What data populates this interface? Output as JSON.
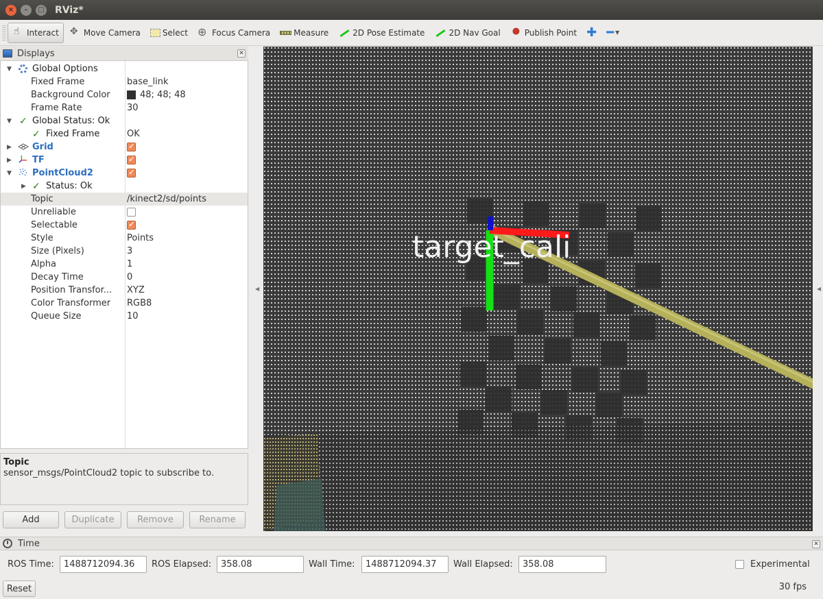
{
  "window": {
    "title": "RViz*"
  },
  "toolbar": {
    "tools": [
      {
        "label": "Interact",
        "icon": "hand-icon",
        "active": true
      },
      {
        "label": "Move Camera",
        "icon": "move-camera-icon"
      },
      {
        "label": "Select",
        "icon": "select-icon"
      },
      {
        "label": "Focus Camera",
        "icon": "focus-camera-icon"
      },
      {
        "label": "Measure",
        "icon": "measure-icon"
      },
      {
        "label": "2D Pose Estimate",
        "icon": "pose-estimate-icon"
      },
      {
        "label": "2D Nav Goal",
        "icon": "nav-goal-icon"
      },
      {
        "label": "Publish Point",
        "icon": "publish-point-icon"
      }
    ],
    "add_tool_icon": "plus-icon",
    "remove_tool_icon": "minus-icon"
  },
  "displays": {
    "title": "Displays",
    "rows": [
      {
        "name": "Global Options",
        "value": ""
      },
      {
        "name": "Fixed Frame",
        "value": "base_link"
      },
      {
        "name": "Background Color",
        "value": "48; 48; 48"
      },
      {
        "name": "Frame Rate",
        "value": "30"
      },
      {
        "name": "Global Status: Ok",
        "value": ""
      },
      {
        "name": "Fixed Frame",
        "value": "OK"
      },
      {
        "name": "Grid",
        "value": ""
      },
      {
        "name": "TF",
        "value": ""
      },
      {
        "name": "PointCloud2",
        "value": ""
      },
      {
        "name": "Status: Ok",
        "value": ""
      },
      {
        "name": "Topic",
        "value": "/kinect2/sd/points"
      },
      {
        "name": "Unreliable",
        "value": ""
      },
      {
        "name": "Selectable",
        "value": ""
      },
      {
        "name": "Style",
        "value": "Points"
      },
      {
        "name": "Size (Pixels)",
        "value": "3"
      },
      {
        "name": "Alpha",
        "value": "1"
      },
      {
        "name": "Decay Time",
        "value": "0"
      },
      {
        "name": "Position Transfor...",
        "value": "XYZ"
      },
      {
        "name": "Color Transformer",
        "value": "RGB8"
      },
      {
        "name": "Queue Size",
        "value": "10"
      }
    ],
    "checked": {
      "grid": true,
      "tf": true,
      "pointcloud2": true,
      "unreliable": false,
      "selectable": true
    },
    "background_color_hex": "#303030",
    "description": {
      "title": "Topic",
      "text": "sensor_msgs/PointCloud2 topic to subscribe to."
    },
    "buttons": {
      "add": "Add",
      "duplicate": "Duplicate",
      "remove": "Remove",
      "rename": "Rename"
    }
  },
  "view": {
    "frame_label": "target_cali",
    "axis_colors": {
      "x": "#ff1a1a",
      "y": "#14e014",
      "z": "#1010c8"
    },
    "arrow_color": "#b5b05a"
  },
  "time": {
    "title": "Time",
    "ros_time_label": "ROS Time:",
    "ros_time": "1488712094.36",
    "ros_elapsed_label": "ROS Elapsed:",
    "ros_elapsed": "358.08",
    "wall_time_label": "Wall Time:",
    "wall_time": "1488712094.37",
    "wall_elapsed_label": "Wall Elapsed:",
    "wall_elapsed": "358.08",
    "experimental_label": "Experimental",
    "experimental": false
  },
  "status": {
    "reset_label": "Reset",
    "fps": "30 fps"
  }
}
